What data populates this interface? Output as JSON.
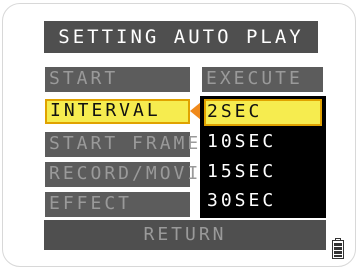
{
  "title": "SETTING AUTO PLAY",
  "menu": {
    "items": [
      {
        "label": "START",
        "selected": false
      },
      {
        "label": "INTERVAL",
        "selected": true
      },
      {
        "label": "START FRAME",
        "selected": false
      },
      {
        "label": "RECORD/MOVIE",
        "selected": false
      },
      {
        "label": "EFFECT",
        "selected": false
      }
    ]
  },
  "options": {
    "header": "EXECUTE",
    "items": [
      {
        "label": "2SEC",
        "selected": true
      },
      {
        "label": "10SEC",
        "selected": false
      },
      {
        "label": "15SEC",
        "selected": false
      },
      {
        "label": "30SEC",
        "selected": false
      }
    ]
  },
  "return_label": "RETURN",
  "icons": {
    "pointer": "arrow-left-icon",
    "battery": "battery-icon"
  },
  "colors": {
    "bar": "#4f4f4f",
    "highlight": "#f6ec4f",
    "highlight_border": "#e0a200",
    "pointer": "#f08a1c"
  }
}
